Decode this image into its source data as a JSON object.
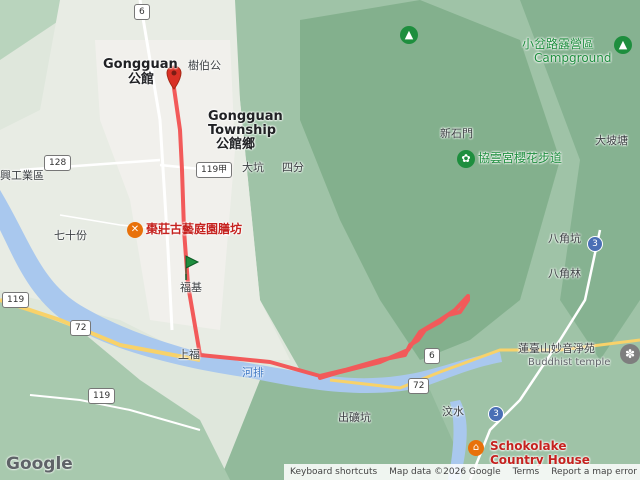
{
  "map": {
    "places": {
      "gongguan_en": "Gongguan",
      "gongguan_zh": "公館",
      "township_en": "Gongguan",
      "township_en2": "Township",
      "township_zh": "公館鄉",
      "shubogong": "樹伯公",
      "dakeng": "大坑",
      "sifen": "四分",
      "qishifen": "七十份",
      "xinggong": "興工業區",
      "fuji": "福基",
      "shangfu": "上福",
      "hepai": "河排",
      "chukuangkeng": "出礦坑",
      "wenshui": "汶水",
      "xinshimen": "新石門",
      "dapotang": "大坡塘",
      "bajiaokeng": "八角坑",
      "bajiaolin": "八角林"
    },
    "poi": {
      "campground_zh": "小岔路露營區",
      "campground_en": "Campground",
      "cherry_trail": "協雲宮櫻花步道",
      "restaurant": "棗莊古藝庭園膳坊",
      "temple_zh": "蓮臺山妙音淨苑",
      "temple_en": "Buddhist temple",
      "schoko_line1": "Schokolake",
      "schoko_line2": "Country House"
    },
    "roads": {
      "r6_top": "6",
      "r128": "128",
      "r119a": "119甲",
      "r119_left": "119",
      "r119_bottom": "119",
      "r72_left": "72",
      "r72_right": "72",
      "r6_right": "6",
      "r3_a": "3",
      "r3_b": "3"
    },
    "colors": {
      "route": "#f25a5a",
      "water": "#a9c8ee",
      "start_marker": "#1e8e3e",
      "end_marker": "#d93025"
    }
  },
  "footer": {
    "logo": "Google",
    "keyboard_shortcuts": "Keyboard shortcuts",
    "map_data": "Map data ©2026 Google",
    "terms": "Terms",
    "report": "Report a map error"
  }
}
